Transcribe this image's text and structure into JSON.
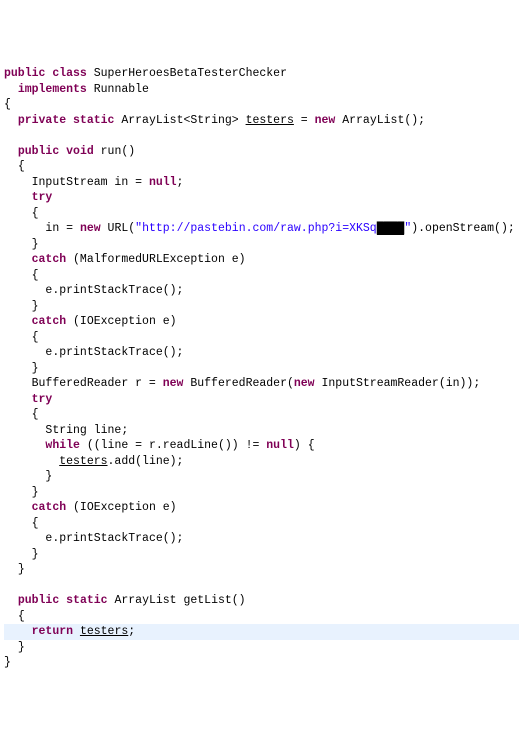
{
  "kw": {
    "public": "public",
    "class": "class",
    "implements": "implements",
    "private": "private",
    "static": "static",
    "void": "void",
    "new": "new",
    "null": "null",
    "try": "try",
    "catch": "catch",
    "while": "while",
    "return": "return"
  },
  "code": {
    "className": "SuperHeroesBetaTesterChecker",
    "runnable": "Runnable",
    "lbrace": "{",
    "rbrace": "}",
    "testersDecl1": " ArrayList<String> ",
    "testersName": "testers",
    "testersDecl2": " = ",
    "testersDecl3": " ArrayList();",
    "runSig": " run()",
    "inDecl": "InputStream in = ",
    "inAssign1": "in = ",
    "inAssign2": " URL(",
    "urlPart1": "\"http://pastebin.com/raw.php?i=XKSq",
    "redacted": "████",
    "urlPart2": "\"",
    "inAssign3": ").openStream();",
    "catchMalformed": " (MalformedURLException e)",
    "catchIO": " (IOException e)",
    "printStack": "e.printStackTrace();",
    "bufReader1": "BufferedReader r = ",
    "bufReader2": " BufferedReader(",
    "bufReader3": " InputStreamReader(in));",
    "stringLine": "String line;",
    "whileCond1": " ((line = r.readLine()) != ",
    "whileCond2": ") {",
    "addLine": ".add(line);",
    "getListSig": " ArrayList getList()",
    "semicolon": ";",
    "space": " "
  }
}
